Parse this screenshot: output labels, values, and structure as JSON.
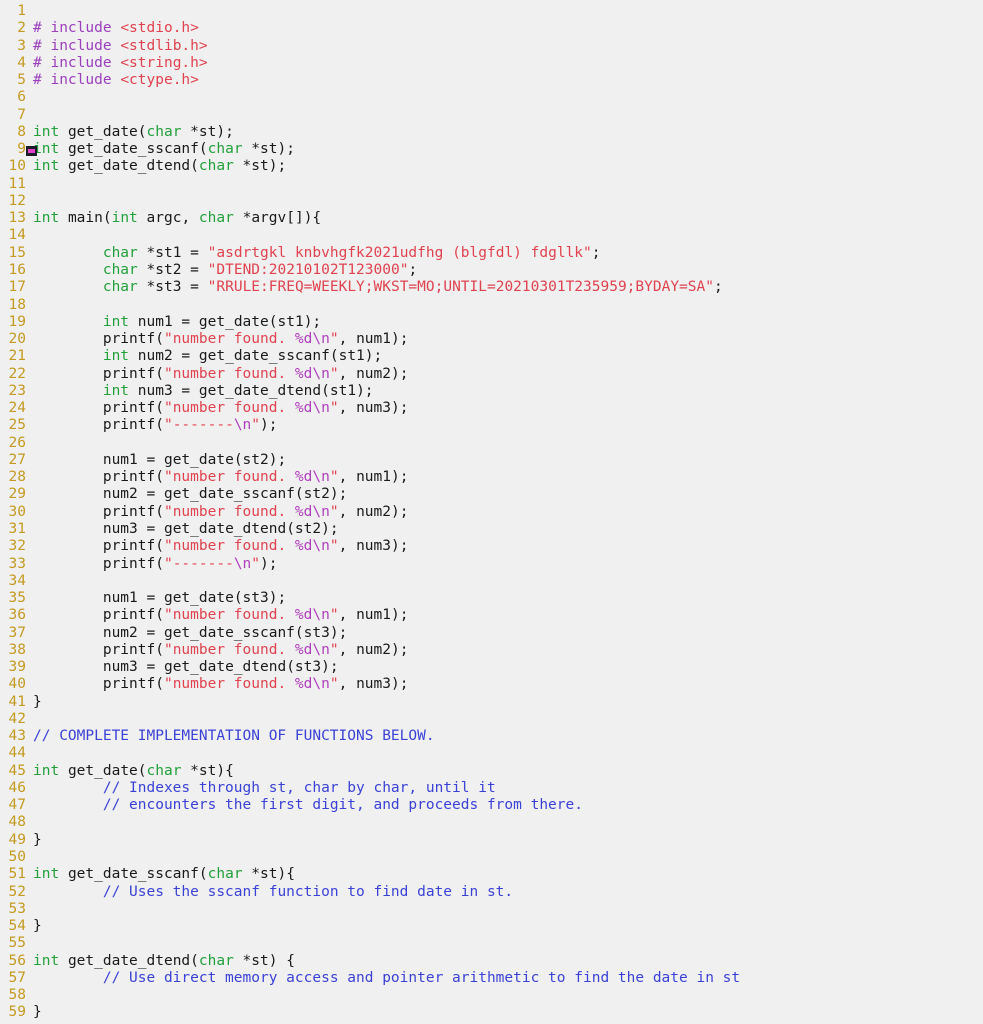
{
  "editor": {
    "language": "C",
    "background_color": "#f0f0f0",
    "gutter_color": "#c49a22",
    "colors": {
      "keyword": "#22a03a",
      "preprocessor": "#9b3fbd",
      "header": "#e0434f",
      "string": "#e0434f",
      "escape": "#b03fbd",
      "comment": "#3a42d6",
      "identifier": "#1a1a1a",
      "caret": "#e040c8"
    },
    "caret_line": 9,
    "total_lines": 59
  },
  "lines": [
    {
      "n": "1",
      "text": ""
    },
    {
      "n": "2",
      "text": "# include <stdio.h>"
    },
    {
      "n": "3",
      "text": "# include <stdlib.h>"
    },
    {
      "n": "4",
      "text": "# include <string.h>"
    },
    {
      "n": "5",
      "text": "# include <ctype.h>"
    },
    {
      "n": "6",
      "text": ""
    },
    {
      "n": "7",
      "text": ""
    },
    {
      "n": "8",
      "text": "int get_date(char *st);"
    },
    {
      "n": "9",
      "text": "int get_date_sscanf(char *st);"
    },
    {
      "n": "10",
      "text": "int get_date_dtend(char *st);"
    },
    {
      "n": "11",
      "text": ""
    },
    {
      "n": "12",
      "text": ""
    },
    {
      "n": "13",
      "text": "int main(int argc, char *argv[]){"
    },
    {
      "n": "14",
      "text": ""
    },
    {
      "n": "15",
      "text": "        char *st1 = \"asdrtgkl knbvhgfk2021udfhg (blgfdl) fdgllk\";"
    },
    {
      "n": "16",
      "text": "        char *st2 = \"DTEND:20210102T123000\";"
    },
    {
      "n": "17",
      "text": "        char *st3 = \"RRULE:FREQ=WEEKLY;WKST=MO;UNTIL=20210301T235959;BYDAY=SA\";"
    },
    {
      "n": "18",
      "text": ""
    },
    {
      "n": "19",
      "text": "        int num1 = get_date(st1);"
    },
    {
      "n": "20",
      "text": "        printf(\"number found. %d\\n\", num1);"
    },
    {
      "n": "21",
      "text": "        int num2 = get_date_sscanf(st1);"
    },
    {
      "n": "22",
      "text": "        printf(\"number found. %d\\n\", num2);"
    },
    {
      "n": "23",
      "text": "        int num3 = get_date_dtend(st1);"
    },
    {
      "n": "24",
      "text": "        printf(\"number found. %d\\n\", num3);"
    },
    {
      "n": "25",
      "text": "        printf(\"-------\\n\");"
    },
    {
      "n": "26",
      "text": ""
    },
    {
      "n": "27",
      "text": "        num1 = get_date(st2);"
    },
    {
      "n": "28",
      "text": "        printf(\"number found. %d\\n\", num1);"
    },
    {
      "n": "29",
      "text": "        num2 = get_date_sscanf(st2);"
    },
    {
      "n": "30",
      "text": "        printf(\"number found. %d\\n\", num2);"
    },
    {
      "n": "31",
      "text": "        num3 = get_date_dtend(st2);"
    },
    {
      "n": "32",
      "text": "        printf(\"number found. %d\\n\", num3);"
    },
    {
      "n": "33",
      "text": "        printf(\"-------\\n\");"
    },
    {
      "n": "34",
      "text": ""
    },
    {
      "n": "35",
      "text": "        num1 = get_date(st3);"
    },
    {
      "n": "36",
      "text": "        printf(\"number found. %d\\n\", num1);"
    },
    {
      "n": "37",
      "text": "        num2 = get_date_sscanf(st3);"
    },
    {
      "n": "38",
      "text": "        printf(\"number found. %d\\n\", num2);"
    },
    {
      "n": "39",
      "text": "        num3 = get_date_dtend(st3);"
    },
    {
      "n": "40",
      "text": "        printf(\"number found. %d\\n\", num3);"
    },
    {
      "n": "41",
      "text": "}"
    },
    {
      "n": "42",
      "text": ""
    },
    {
      "n": "43",
      "text": "// COMPLETE IMPLEMENTATION OF FUNCTIONS BELOW."
    },
    {
      "n": "44",
      "text": ""
    },
    {
      "n": "45",
      "text": "int get_date(char *st){"
    },
    {
      "n": "46",
      "text": "        // Indexes through st, char by char, until it"
    },
    {
      "n": "47",
      "text": "        // encounters the first digit, and proceeds from there."
    },
    {
      "n": "48",
      "text": ""
    },
    {
      "n": "49",
      "text": "}"
    },
    {
      "n": "50",
      "text": ""
    },
    {
      "n": "51",
      "text": "int get_date_sscanf(char *st){"
    },
    {
      "n": "52",
      "text": "        // Uses the sscanf function to find date in st."
    },
    {
      "n": "53",
      "text": ""
    },
    {
      "n": "54",
      "text": "}"
    },
    {
      "n": "55",
      "text": ""
    },
    {
      "n": "56",
      "text": "int get_date_dtend(char *st) {"
    },
    {
      "n": "57",
      "text": "        // Use direct memory access and pointer arithmetic to find the date in st"
    },
    {
      "n": "58",
      "text": ""
    },
    {
      "n": "59",
      "text": "}"
    }
  ]
}
